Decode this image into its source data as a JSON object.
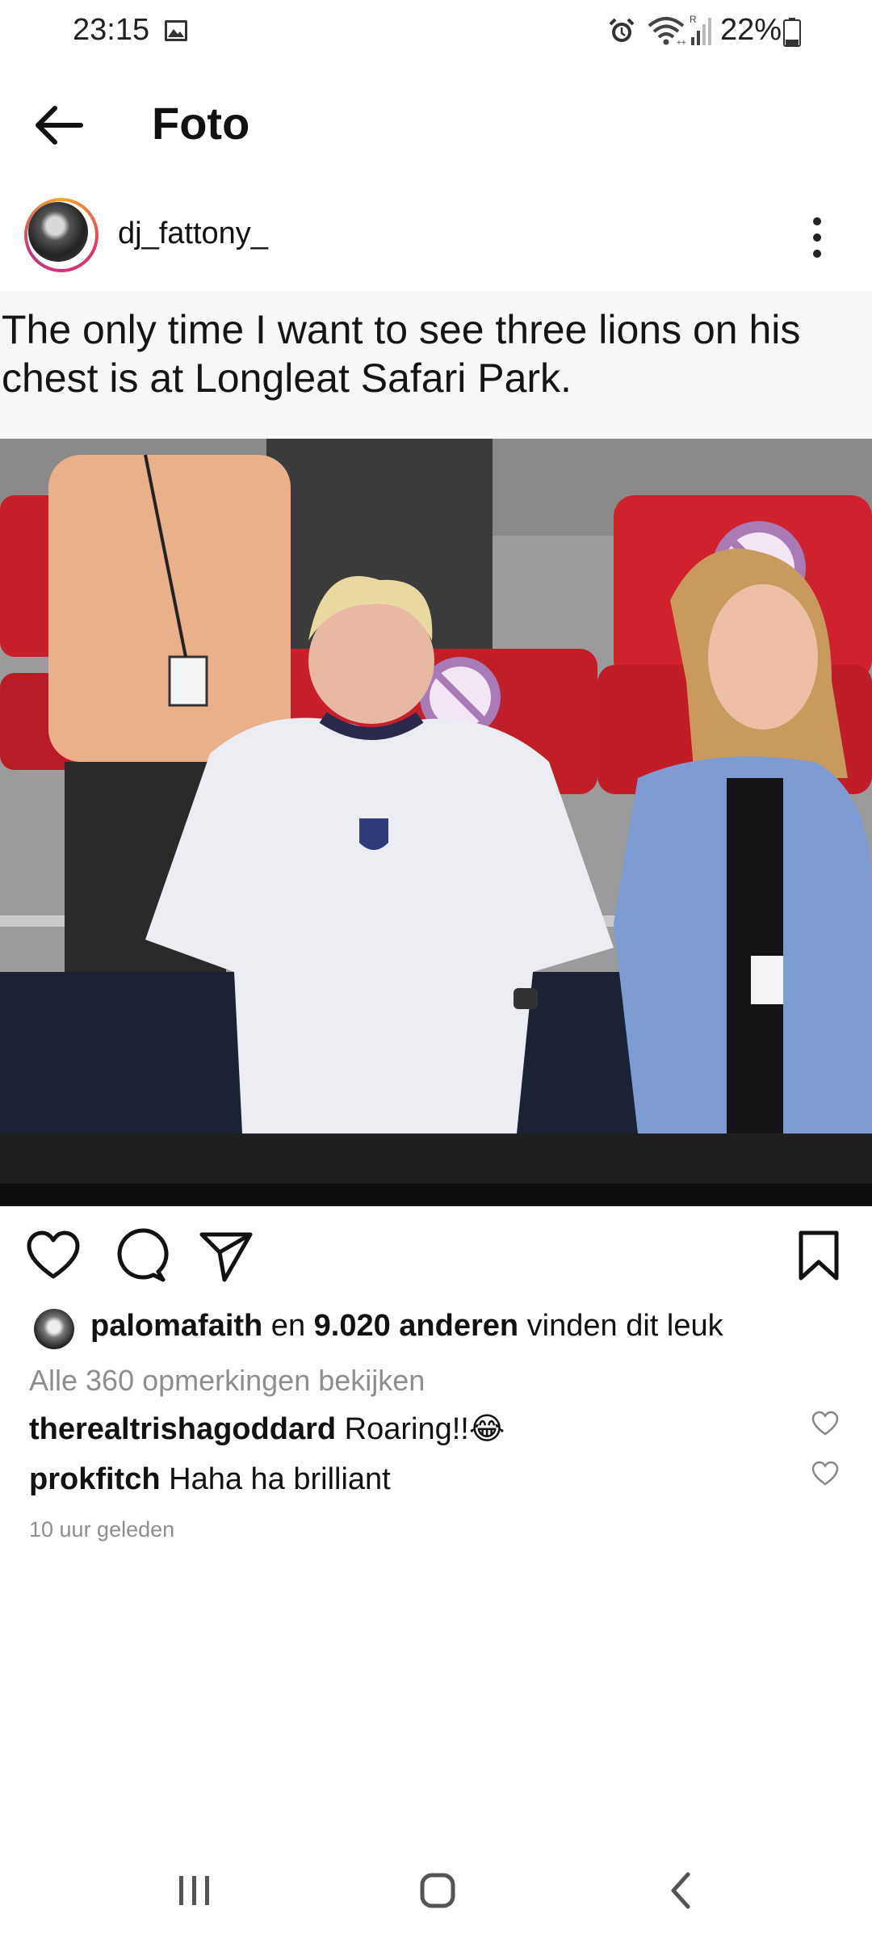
{
  "status_bar": {
    "time": "23:15",
    "battery": "22%",
    "icons": [
      "gallery-icon",
      "alarm-icon",
      "wifi-icon",
      "signal-icon",
      "battery-icon"
    ]
  },
  "header": {
    "title": "Foto",
    "back_icon": "arrow-left-icon"
  },
  "post": {
    "username": "dj_fattony_",
    "image_caption": "The only time I want to see three lions on his chest is at Longleat Safari Park.",
    "likes": {
      "user": "palomafaith",
      "connector": " en ",
      "count_text": "9.020 anderen",
      "suffix": " vinden dit leuk"
    },
    "view_comments": "Alle 360 opmerkingen bekijken",
    "comments": [
      {
        "user": "therealtrishagoddard",
        "text": " Roaring!!😂"
      },
      {
        "user": "prokfitch",
        "text": " Haha ha brilliant"
      }
    ],
    "time_ago": "10 uur geleden"
  },
  "nav_bar": {
    "icons": [
      "recent-apps-icon",
      "home-icon",
      "back-icon"
    ]
  },
  "colors": {
    "seat_red": "#c8202a",
    "accent_story_ring": "#e1306c"
  }
}
